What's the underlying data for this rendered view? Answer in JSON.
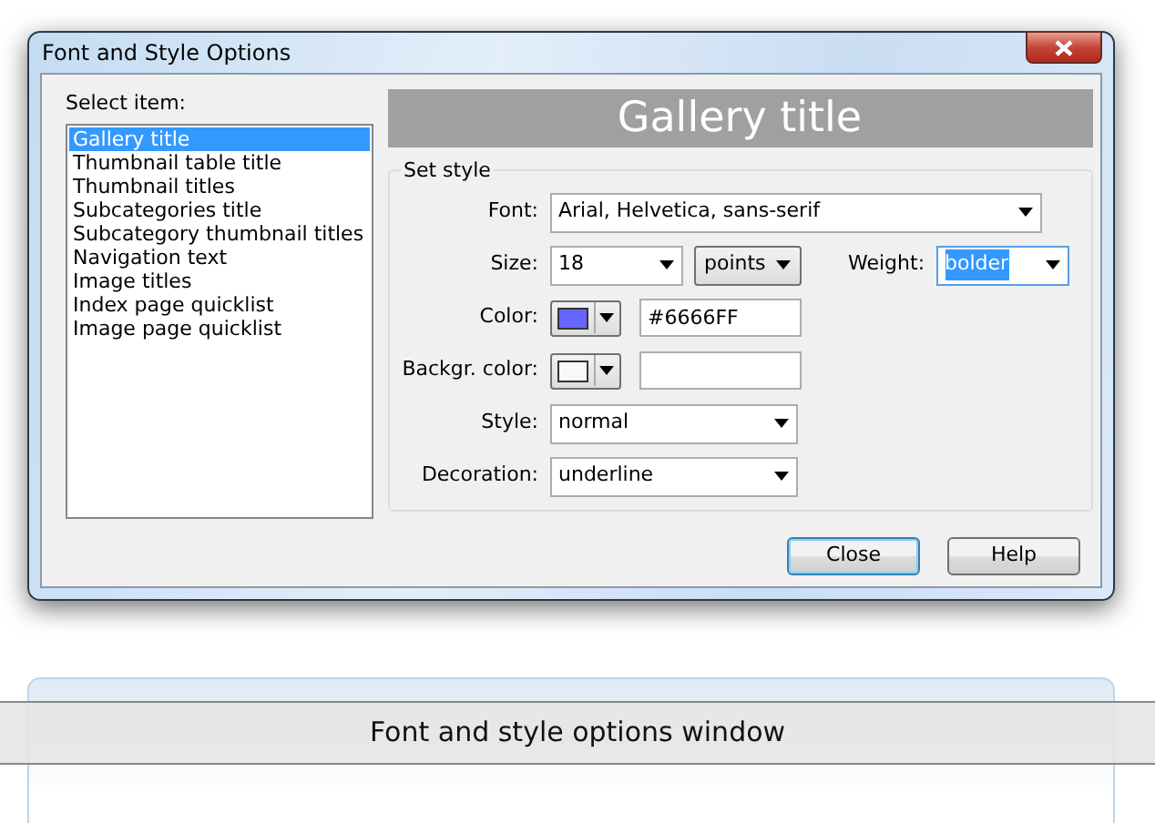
{
  "window": {
    "title": "Font and Style Options"
  },
  "item_list": {
    "label": "Select item:",
    "items": [
      {
        "label": "Gallery title",
        "selected": true
      },
      {
        "label": "Thumbnail table title",
        "selected": false
      },
      {
        "label": "Thumbnail titles",
        "selected": false
      },
      {
        "label": "Subcategories title",
        "selected": false
      },
      {
        "label": "Subcategory thumbnail titles",
        "selected": false
      },
      {
        "label": "Navigation text",
        "selected": false
      },
      {
        "label": "Image titles",
        "selected": false
      },
      {
        "label": "Index page quicklist",
        "selected": false
      },
      {
        "label": "Image page quicklist",
        "selected": false
      }
    ]
  },
  "preview": {
    "text": "Gallery title"
  },
  "set_style": {
    "legend": "Set style",
    "font": {
      "label": "Font:",
      "value": "Arial, Helvetica, sans-serif"
    },
    "size": {
      "label": "Size:",
      "value": "18",
      "unit": "points"
    },
    "weight": {
      "label": "Weight:",
      "value": "bolder",
      "text_selected": true
    },
    "color_pickers": [
      {
        "label": "Color:",
        "color": "#6666ff",
        "value": "#6666FF"
      },
      {
        "label": "Backgr. color:",
        "color": "#f8f8f8"
      }
    ],
    "style": {
      "label": "Style:",
      "value": "normal"
    },
    "decoration": {
      "label": "Decoration:",
      "value": "underline"
    }
  },
  "buttons": [
    {
      "label": "Close",
      "default": true
    },
    {
      "label": "Help",
      "default": false
    }
  ],
  "caption": "Font and style options window"
}
